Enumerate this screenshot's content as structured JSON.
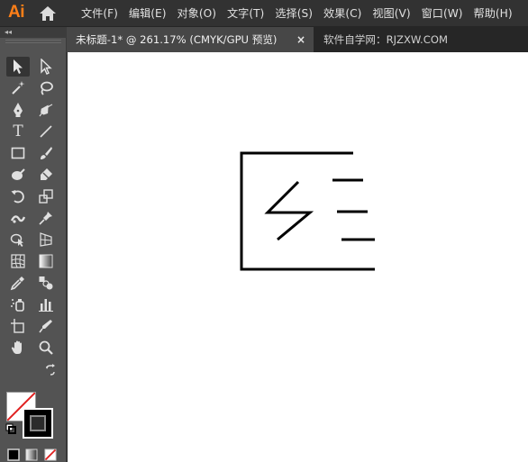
{
  "app": {
    "logo": "Ai"
  },
  "menu": {
    "items": [
      {
        "label": "文件(F)"
      },
      {
        "label": "编辑(E)"
      },
      {
        "label": "对象(O)"
      },
      {
        "label": "文字(T)"
      },
      {
        "label": "选择(S)"
      },
      {
        "label": "效果(C)"
      },
      {
        "label": "视图(V)"
      },
      {
        "label": "窗口(W)"
      },
      {
        "label": "帮助(H)"
      }
    ]
  },
  "tabs": {
    "active": {
      "title": "未标题-1* @ 261.17% (CMYK/GPU 预览)",
      "close": "×"
    },
    "other": {
      "title": "软件自学网：RJZXW.COM"
    }
  },
  "toolbar": {
    "collapse": "◂◂",
    "type_tool_glyph": "T"
  },
  "colors": {
    "menubar_bg": "#323232",
    "toolbar_bg": "#535353",
    "logo": "#ff7f18",
    "canvas_bg": "#ffffff",
    "artwork_stroke": "#000000",
    "none_slash": "#e02020"
  }
}
